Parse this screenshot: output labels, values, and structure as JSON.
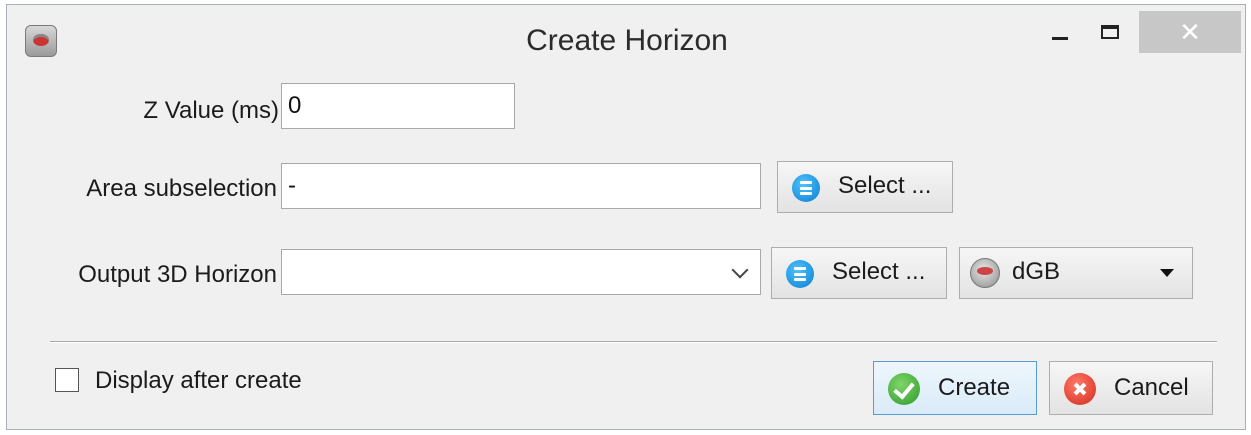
{
  "window": {
    "title": "Create Horizon",
    "close_symbol": "✕",
    "icon": "app-logo-icon"
  },
  "form": {
    "z_value": {
      "label": "Z Value (ms)",
      "value": "0"
    },
    "area_subselection": {
      "label": "Area subselection",
      "value": "-",
      "button_label": "Select ..."
    },
    "output_horizon": {
      "label": "Output 3D Horizon",
      "value": "",
      "button_label": "Select ...",
      "source_value": "dGB"
    }
  },
  "footer": {
    "display_after_create_label": "Display after create",
    "display_after_create_checked": false,
    "create_label": "Create",
    "cancel_label": "Cancel"
  },
  "colors": {
    "accent_blue": "#0a7fcf",
    "create_green": "#2f9a2a",
    "cancel_red": "#d22a1a",
    "focus_border": "#5b9bd5"
  }
}
